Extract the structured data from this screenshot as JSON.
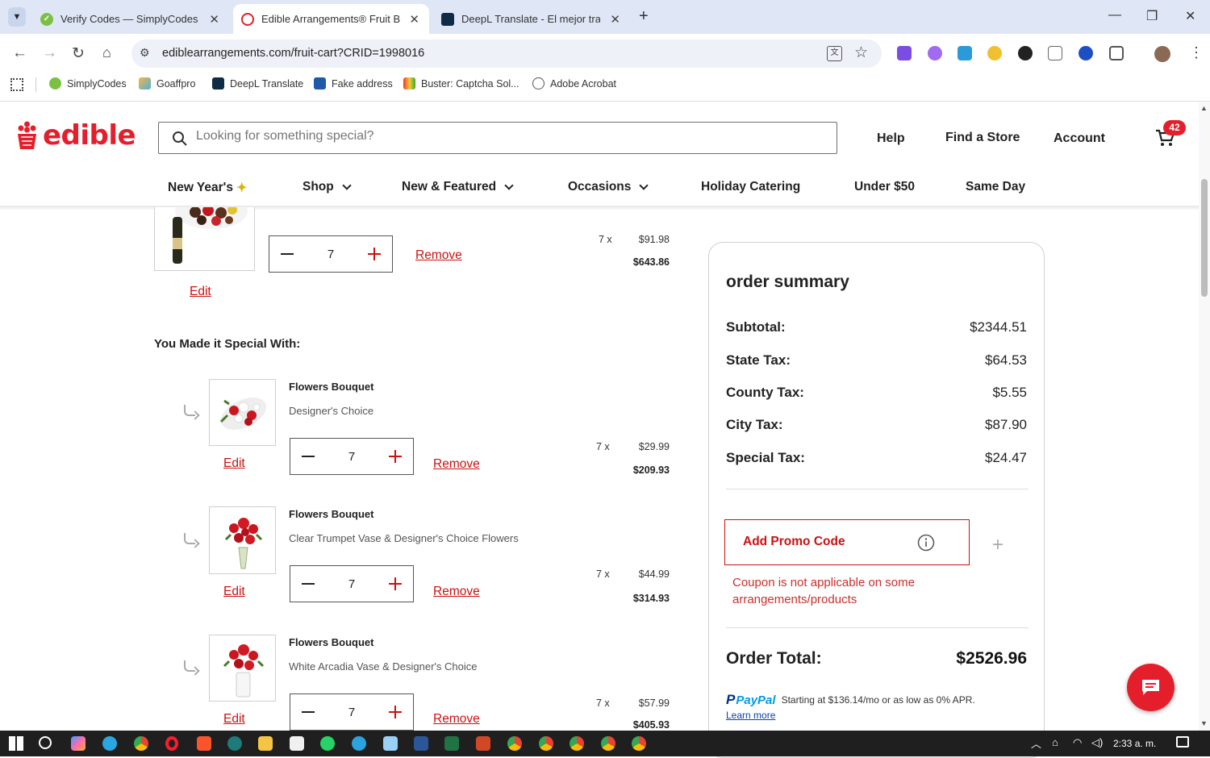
{
  "browser": {
    "tabs": [
      {
        "title": "Verify Codes — SimplyCodes",
        "active": false
      },
      {
        "title": "Edible Arrangements® Fruit Ba",
        "active": true
      },
      {
        "title": "DeepL Translate - El mejor tradu",
        "active": false
      }
    ],
    "url": "ediblearrangements.com/fruit-cart?CRID=1998016",
    "bookmarks": [
      "SimplyCodes",
      "Goaffpro",
      "DeepL Translate",
      "Fake address",
      "Buster: Captcha Sol...",
      "Adobe Acrobat"
    ]
  },
  "site": {
    "logo_text": "edible",
    "search_placeholder": "Looking for something special?",
    "header_links": [
      "Help",
      "Find a Store",
      "Account"
    ],
    "cart_count": "42",
    "nav": [
      {
        "label": "New Year's",
        "has_chevron": false
      },
      {
        "label": "Shop",
        "has_chevron": true
      },
      {
        "label": "New & Featured",
        "has_chevron": true
      },
      {
        "label": "Occasions",
        "has_chevron": true
      },
      {
        "label": "Holiday Catering",
        "has_chevron": false
      },
      {
        "label": "Under $50",
        "has_chevron": false
      },
      {
        "label": "Same Day",
        "has_chevron": false
      }
    ]
  },
  "cart": {
    "main_item": {
      "qty": "7",
      "qty_label": "7 x",
      "unit_price": "$91.98",
      "line_total": "$643.86",
      "edit_label": "Edit",
      "remove_label": "Remove"
    },
    "addons_heading": "You Made it Special With:",
    "addons": [
      {
        "name": "Flowers Bouquet",
        "desc": "Designer's Choice",
        "qty": "7",
        "qty_label": "7 x",
        "unit_price": "$29.99",
        "line_total": "$209.93",
        "edit_label": "Edit",
        "remove_label": "Remove"
      },
      {
        "name": "Flowers Bouquet",
        "desc": "Clear Trumpet Vase & Designer's Choice Flowers",
        "qty": "7",
        "qty_label": "7 x",
        "unit_price": "$44.99",
        "line_total": "$314.93",
        "edit_label": "Edit",
        "remove_label": "Remove"
      },
      {
        "name": "Flowers Bouquet",
        "desc": "White Arcadia Vase & Designer's Choice",
        "qty": "7",
        "qty_label": "7 x",
        "unit_price": "$57.99",
        "line_total": "$405.93",
        "edit_label": "Edit",
        "remove_label": "Remove"
      }
    ]
  },
  "summary": {
    "title": "order summary",
    "rows": [
      {
        "label": "Subtotal:",
        "value": "$2344.51"
      },
      {
        "label": "State Tax:",
        "value": "$64.53"
      },
      {
        "label": "County Tax:",
        "value": "$5.55"
      },
      {
        "label": "City Tax:",
        "value": "$87.90"
      },
      {
        "label": "Special Tax:",
        "value": "$24.47"
      }
    ],
    "promo_label": "Add Promo Code",
    "promo_error": "Coupon is not applicable on some arrangements/products",
    "total_label": "Order Total:",
    "total_value": "$2526.96",
    "paypal_brand": "PayPal",
    "paypal_text": "Starting at $136.14/mo or as low as 0% APR.",
    "paypal_link": "Learn more"
  },
  "taskbar": {
    "clock": "2:33 a. m."
  },
  "colors": {
    "brand_red": "#e41f2b",
    "link_red": "#cc1111",
    "tab_bar": "#dfe7f6"
  }
}
